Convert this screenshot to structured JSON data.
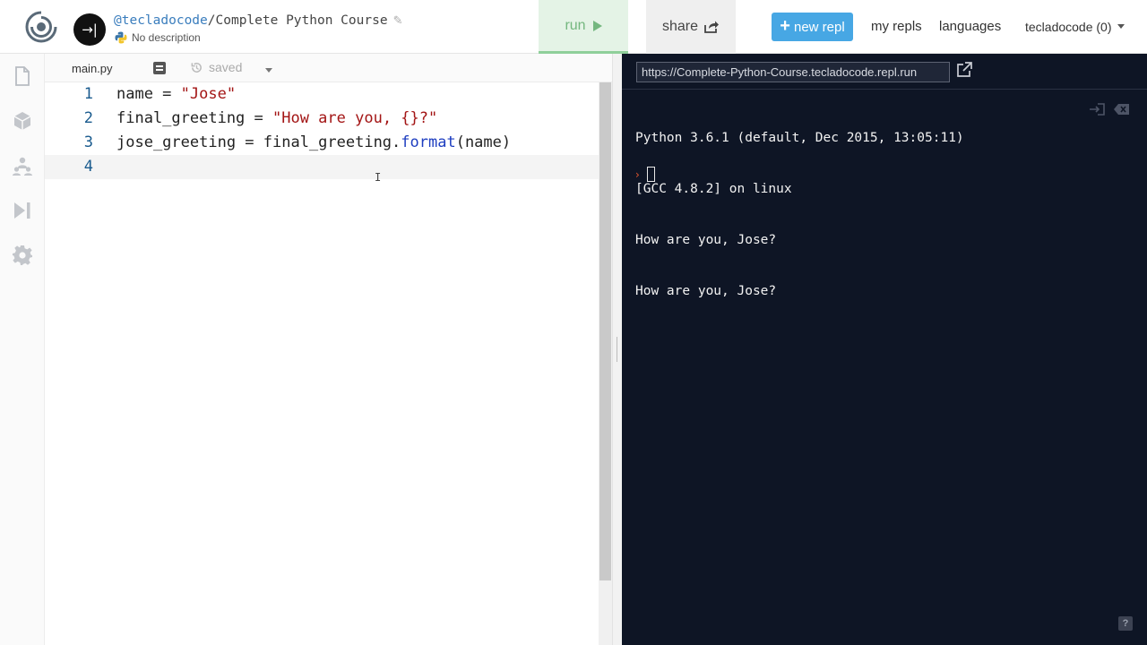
{
  "header": {
    "user": "@tecladocode",
    "separator": "/",
    "repl_name": "Complete Python Course",
    "description": "No description",
    "run_label": "run",
    "share_label": "share",
    "new_repl_plus": "+",
    "new_repl_label": "new repl",
    "my_repls_label": "my repls",
    "languages_label": "languages",
    "account_label": "tecladocode (0)",
    "toggle_glyph": "→|"
  },
  "sidebar": {
    "items": [
      "files-icon",
      "packages-icon",
      "multiplayer-icon",
      "debugger-icon",
      "settings-icon"
    ]
  },
  "editor": {
    "tab_label": "main.py",
    "saved_label": "saved",
    "lines": [
      {
        "num": "1",
        "parts": [
          {
            "t": "name = ",
            "c": "plain"
          },
          {
            "t": "\"Jose\"",
            "c": "str"
          }
        ]
      },
      {
        "num": "2",
        "parts": [
          {
            "t": "final_greeting = ",
            "c": "plain"
          },
          {
            "t": "\"How are you, {}?\"",
            "c": "str"
          }
        ]
      },
      {
        "num": "3",
        "parts": [
          {
            "t": "jose_greeting = final_greeting.",
            "c": "plain"
          },
          {
            "t": "format",
            "c": "fn"
          },
          {
            "t": "(name)",
            "c": "plain"
          }
        ]
      },
      {
        "num": "4",
        "parts": []
      }
    ],
    "active_line": 4
  },
  "console": {
    "url": "https://Complete-Python-Course.tecladocode.repl.run",
    "output_lines": [
      "Python 3.6.1 (default, Dec 2015, 13:05:11)",
      "[GCC 4.8.2] on linux",
      "How are you, Jose?",
      "How are you, Jose?"
    ],
    "prompt_glyph": "›",
    "help_label": "?"
  },
  "colors": {
    "run_bg": "#e4f3e6",
    "run_text": "#74b77f",
    "new_repl_bg": "#47a7e4",
    "console_bg": "#0e1525",
    "string_color": "#a31515",
    "function_color": "#1e3ec0",
    "line_number_color": "#1a5b8e"
  }
}
